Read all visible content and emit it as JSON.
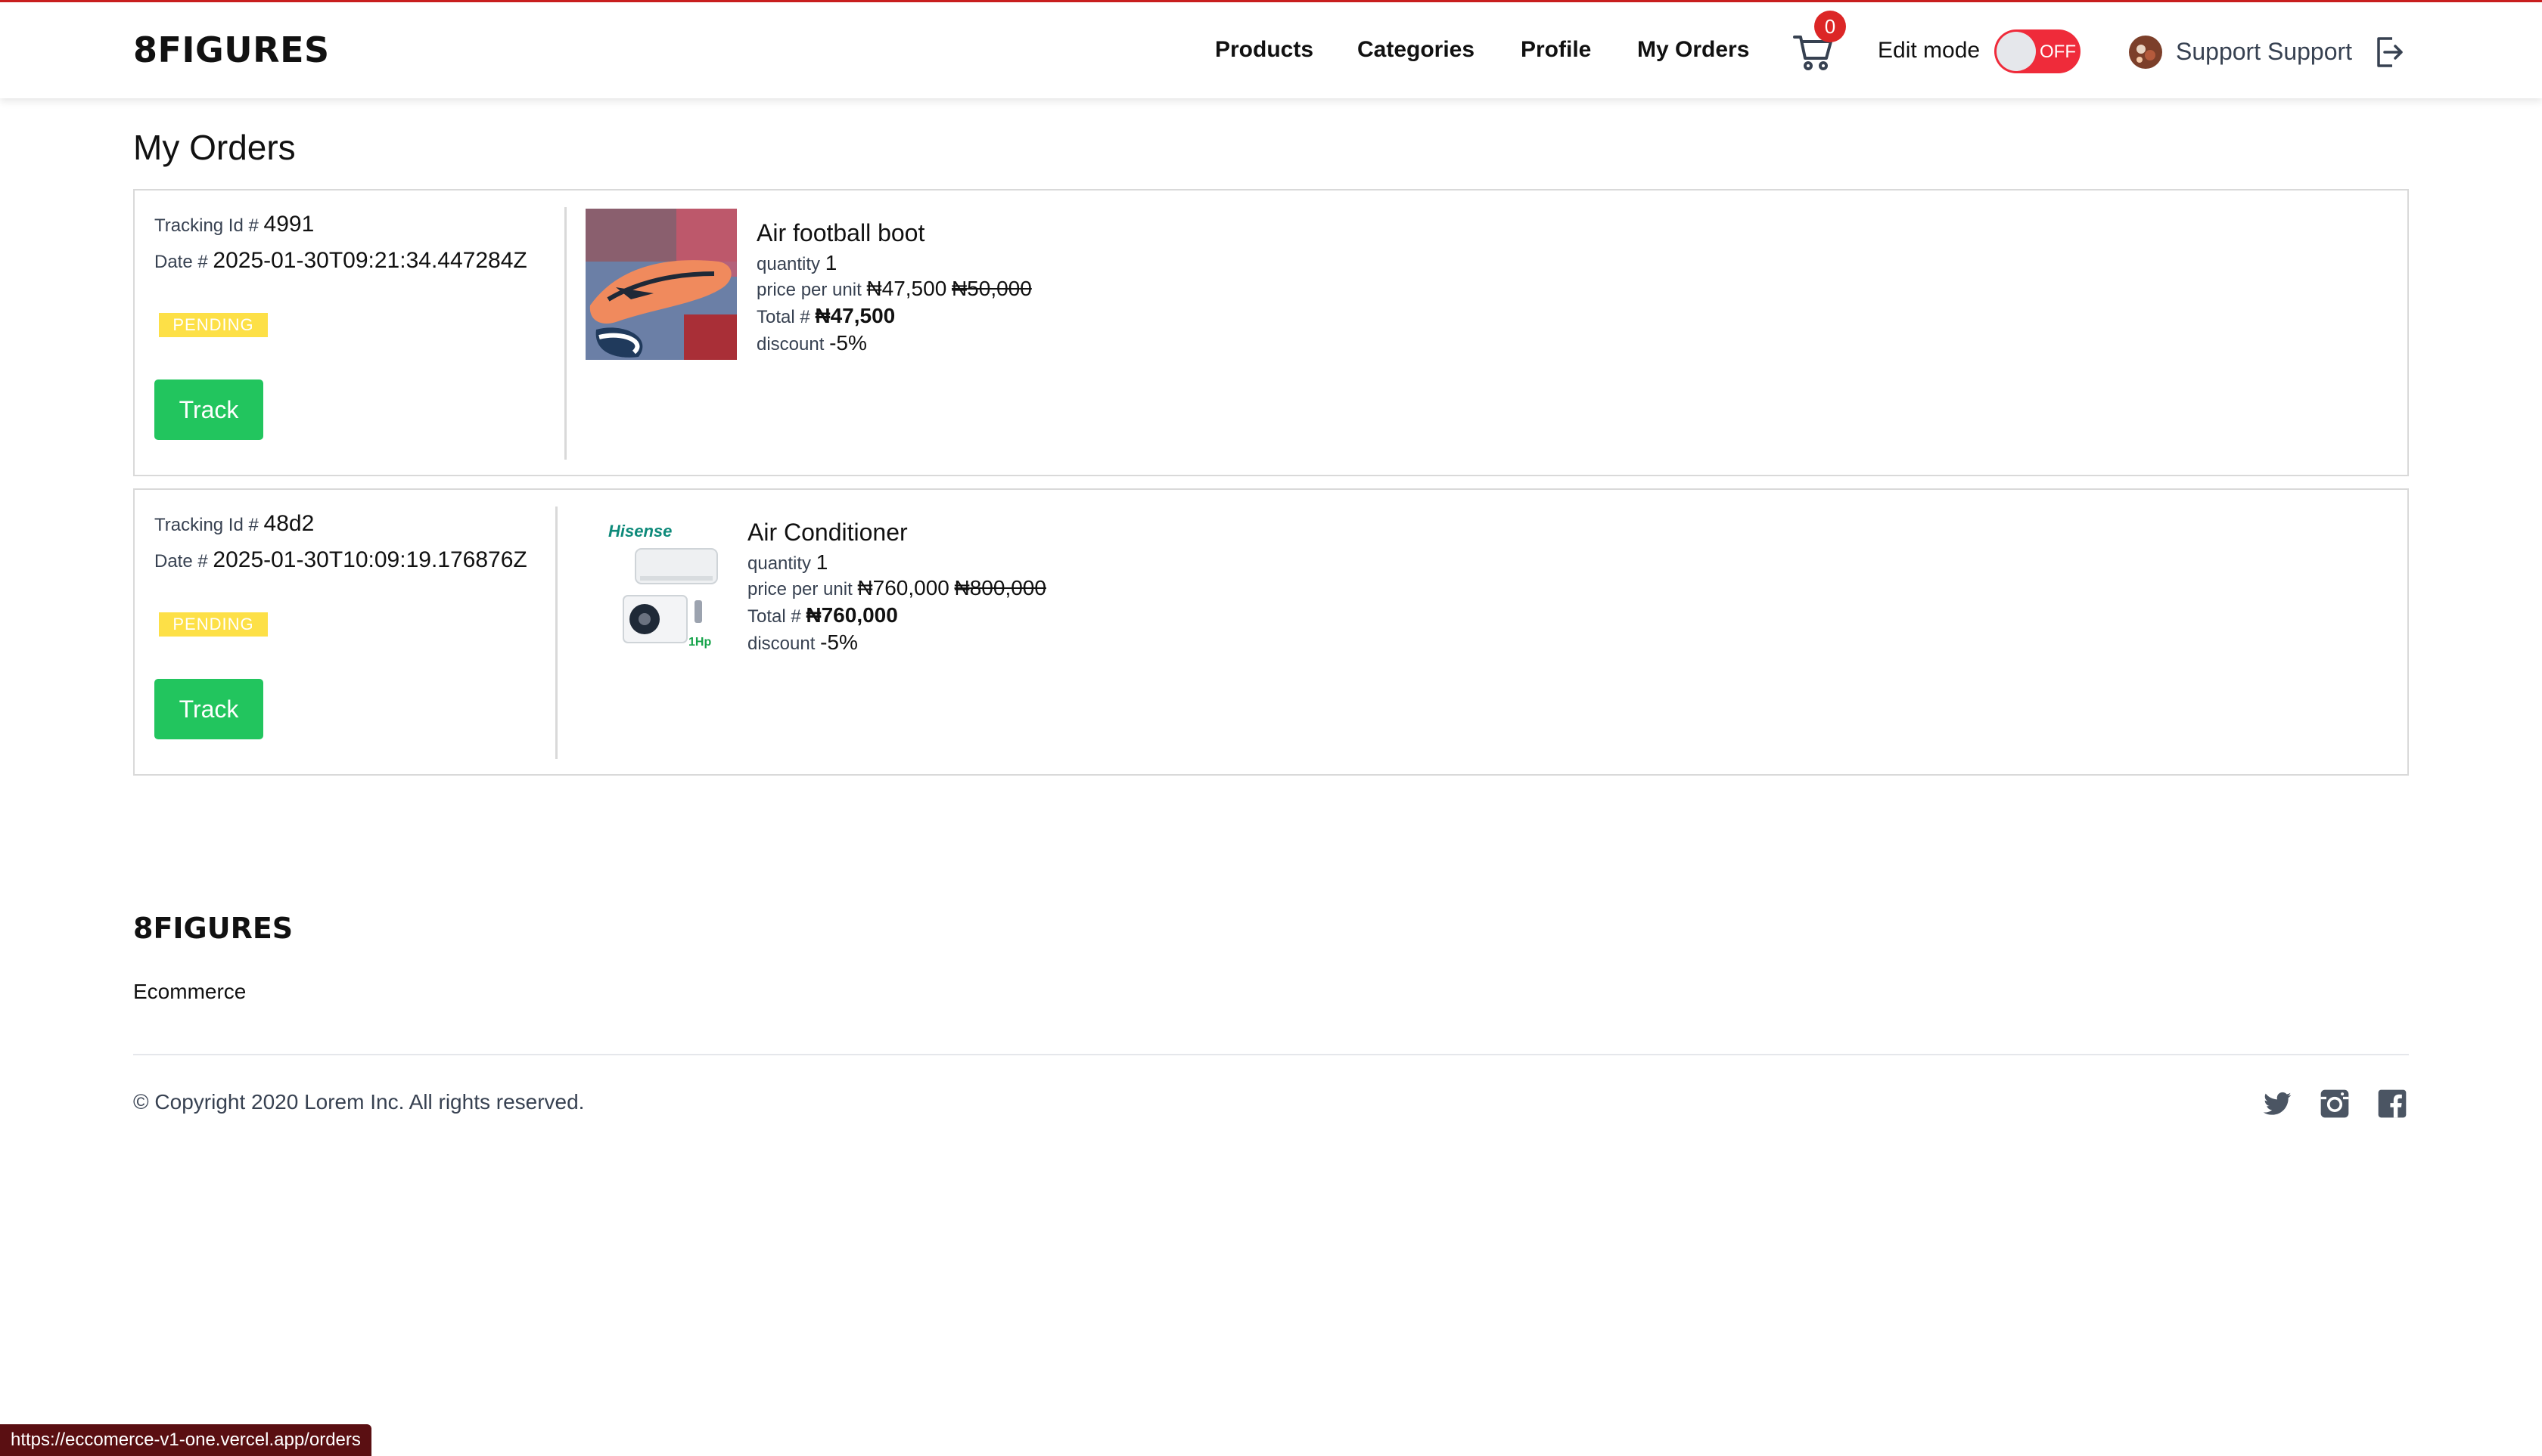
{
  "header": {
    "brand": "8FIGURES",
    "nav": [
      "Products",
      "Categories",
      "Profile",
      "My Orders"
    ],
    "cart_count": "0",
    "edit_mode_label": "Edit mode",
    "edit_toggle_state": "OFF",
    "user_name": "Support Support"
  },
  "page": {
    "title": "My Orders"
  },
  "labels": {
    "tracking": "Tracking Id # ",
    "date": "Date # ",
    "quantity": "quantity ",
    "price_per_unit": "price per unit ",
    "total": "Total # ",
    "discount": "discount ",
    "track_button": "Track"
  },
  "orders": [
    {
      "tracking_id": "4991",
      "date": "2025-01-30T09:21:34.447284Z",
      "status": "PENDING",
      "item": {
        "name": "Air football boot",
        "quantity": "1",
        "price": "₦47,500",
        "old_price": "₦50,000",
        "total": "₦47,500",
        "discount": "-5%"
      }
    },
    {
      "tracking_id": "48d2",
      "date": "2025-01-30T10:09:19.176876Z",
      "status": "PENDING",
      "item": {
        "name": "Air Conditioner",
        "quantity": "1",
        "price": "₦760,000",
        "old_price": "₦800,000",
        "total": "₦760,000",
        "discount": "-5%",
        "image_text": [
          "Hisense",
          "1Hp"
        ]
      }
    }
  ],
  "footer": {
    "brand": "8FIGURES",
    "tagline": "Ecommerce",
    "copyright": "© Copyright 2020 Lorem Inc. All rights reserved.",
    "social_icons": [
      "twitter-icon",
      "instagram-icon",
      "facebook-icon"
    ]
  },
  "status_bar": {
    "url": "https://eccomerce-v1-one.vercel.app/orders"
  },
  "colors": {
    "header_border": "#c81e1e",
    "toggle_off": "#ef2b3a",
    "badge_pending": "#fde047",
    "track_button": "#22c55e",
    "cart_badge": "#dc2626"
  }
}
